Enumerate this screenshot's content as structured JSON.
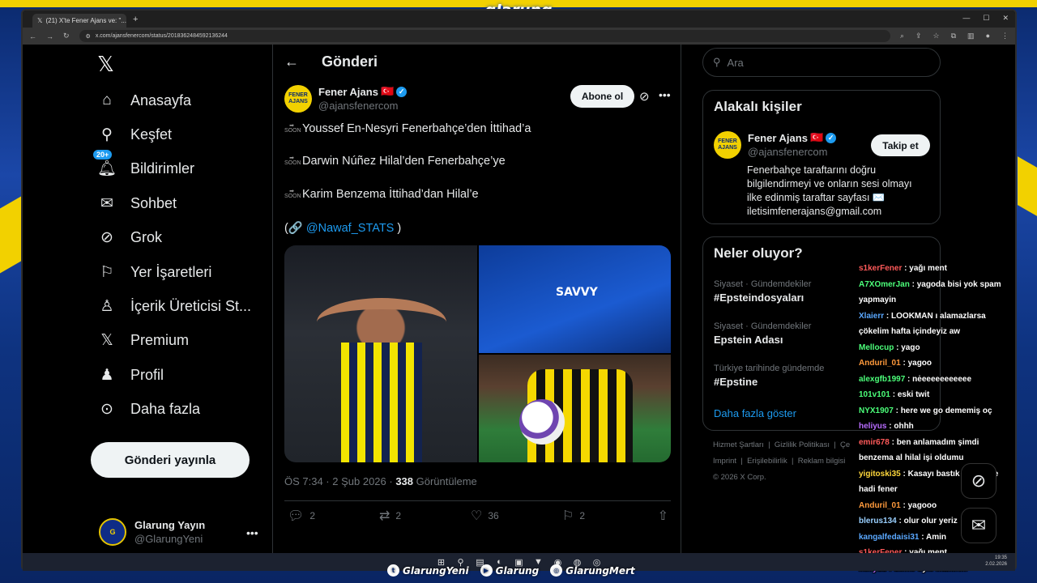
{
  "overlay": {
    "brand": "glarung"
  },
  "browser": {
    "tab_title": "(21) X'te Fener Ajans ve: \"...",
    "url": "x.com/ajansfenercom/status/2018362484592136244"
  },
  "nav": {
    "items": [
      {
        "label": "Anasayfa",
        "icon": "home-icon"
      },
      {
        "label": "Keşfet",
        "icon": "search-icon"
      },
      {
        "label": "Bildirimler",
        "icon": "bell-icon",
        "badge": "20+"
      },
      {
        "label": "Sohbet",
        "icon": "mail-icon"
      },
      {
        "label": "Grok",
        "icon": "grok-icon"
      },
      {
        "label": "Yer İşaretleri",
        "icon": "bookmark-icon"
      },
      {
        "label": "İçerik Üreticisi St...",
        "icon": "creator-icon"
      },
      {
        "label": "Premium",
        "icon": "x-icon"
      },
      {
        "label": "Profil",
        "icon": "profile-icon"
      },
      {
        "label": "Daha fazla",
        "icon": "more-icon"
      }
    ],
    "post_button": "Gönderi yayınla",
    "me": {
      "name": "Glarung Yayın",
      "handle": "@GlarungYeni"
    }
  },
  "main": {
    "header": "Gönderi",
    "author": {
      "name": "Fener Ajans",
      "flag": "🇹🇷",
      "handle": "@ajansfenercom",
      "avatar_text": "FENER AJANS"
    },
    "subscribe": "Abone ol",
    "lines": [
      "Youssef En-Nesyri Fenerbahçe’den İttihad’a",
      "Darwin Núñez Hilal’den Fenerbahçe’ye",
      "Karim Benzema İttihad’dan Hilal’e"
    ],
    "soon_label": "SOON",
    "credit_open": "(🔗",
    "credit_link": "@Nawaf_STATS",
    "credit_close": ")",
    "time": "ÖS 7:34 · 2 Şub 2026 · ",
    "views": "338",
    "views_label": " Görüntüleme",
    "actions": {
      "replies": "2",
      "reposts": "2",
      "likes": "36",
      "bookmarks": "2"
    },
    "image_text": {
      "jersey_sponsor": "SAVVY"
    }
  },
  "side": {
    "search_placeholder": "Ara",
    "relevant": {
      "title": "Alakalı kişiler",
      "name": "Fener Ajans",
      "handle": "@ajansfenercom",
      "follow": "Takip et",
      "bio": "Fenerbahçe taraftarını doğru bilgilendirmeyi ve onların sesi olmayı ilke edinmiş taraftar sayfası ✉️ iletisimfenerajans@gmail.com"
    },
    "trends": {
      "title": "Neler oluyor?",
      "items": [
        {
          "meta": "Siyaset · Gündemdekiler",
          "title": "#Epsteindosyaları"
        },
        {
          "meta": "Siyaset · Gündemdekiler",
          "title": "Epstein Adası"
        },
        {
          "meta": "Türkiye tarihinde gündemde",
          "title": "#Epstine"
        }
      ],
      "show_more": "Daha fazla göster"
    },
    "footer": [
      "Hizmet Şartları",
      "Gizlilik Politikası",
      "Çe",
      "Imprint",
      "Erişilebilirlik",
      "Reklam bilgisi",
      "© 2026 X Corp."
    ]
  },
  "chat": [
    {
      "user": "s1kerFener",
      "color": "#ff5a5a",
      "msg": ": yağı ment"
    },
    {
      "user": "A7XOmerJan",
      "color": "#4cff7a",
      "msg": ": yagoda bisi yok spam yapmayin"
    },
    {
      "user": "Xlaierr",
      "color": "#5aa8ff",
      "msg": ": LOOKMAN ı alamazlarsa çökelim hafta içindeyiz aw"
    },
    {
      "user": "Mellocup",
      "color": "#4cff7a",
      "msg": ": yago"
    },
    {
      "user": "Anduril_01",
      "color": "#ff9a3c",
      "msg": ": yagoo"
    },
    {
      "user": "alexgfb1997",
      "color": "#4cff7a",
      "msg": ": nėeeeeeeeeeee"
    },
    {
      "user": "101v101",
      "color": "#4cff7a",
      "msg": ": eski twit"
    },
    {
      "user": "NYX1907",
      "color": "#4cff7a",
      "msg": ": here we go dememiş oç"
    },
    {
      "user": "heliyus",
      "color": "#b86cff",
      "msg": ": ohhh"
    },
    {
      "user": "emir678",
      "color": "#ff5a5a",
      "msg": ": ben anlamadım şimdi benzema al hilal işi oldumu"
    },
    {
      "user": "yigitoski35",
      "color": "#ffd83c",
      "msg": ": Kasayı bastık kocaeliye hadi fener"
    },
    {
      "user": "Anduril_01",
      "color": "#ff9a3c",
      "msg": ": yagooo"
    },
    {
      "user": "blerus134",
      "color": "#9ad0ff",
      "msg": ": olur olur yeriz"
    },
    {
      "user": "kangalfedaisi31",
      "color": "#5aa8ff",
      "msg": ": Amin"
    },
    {
      "user": "s1kerFener",
      "color": "#ff5a5a",
      "msg": ": yağı ment"
    },
    {
      "user": "heliyus",
      "color": "#b86cff",
      "msg": ": deme öyle inanırım"
    }
  ],
  "socials": [
    "GlarungYeni",
    "Glarung",
    "GlarungMert"
  ],
  "tray": {
    "time": "19:35",
    "date": "2.02.2026"
  }
}
